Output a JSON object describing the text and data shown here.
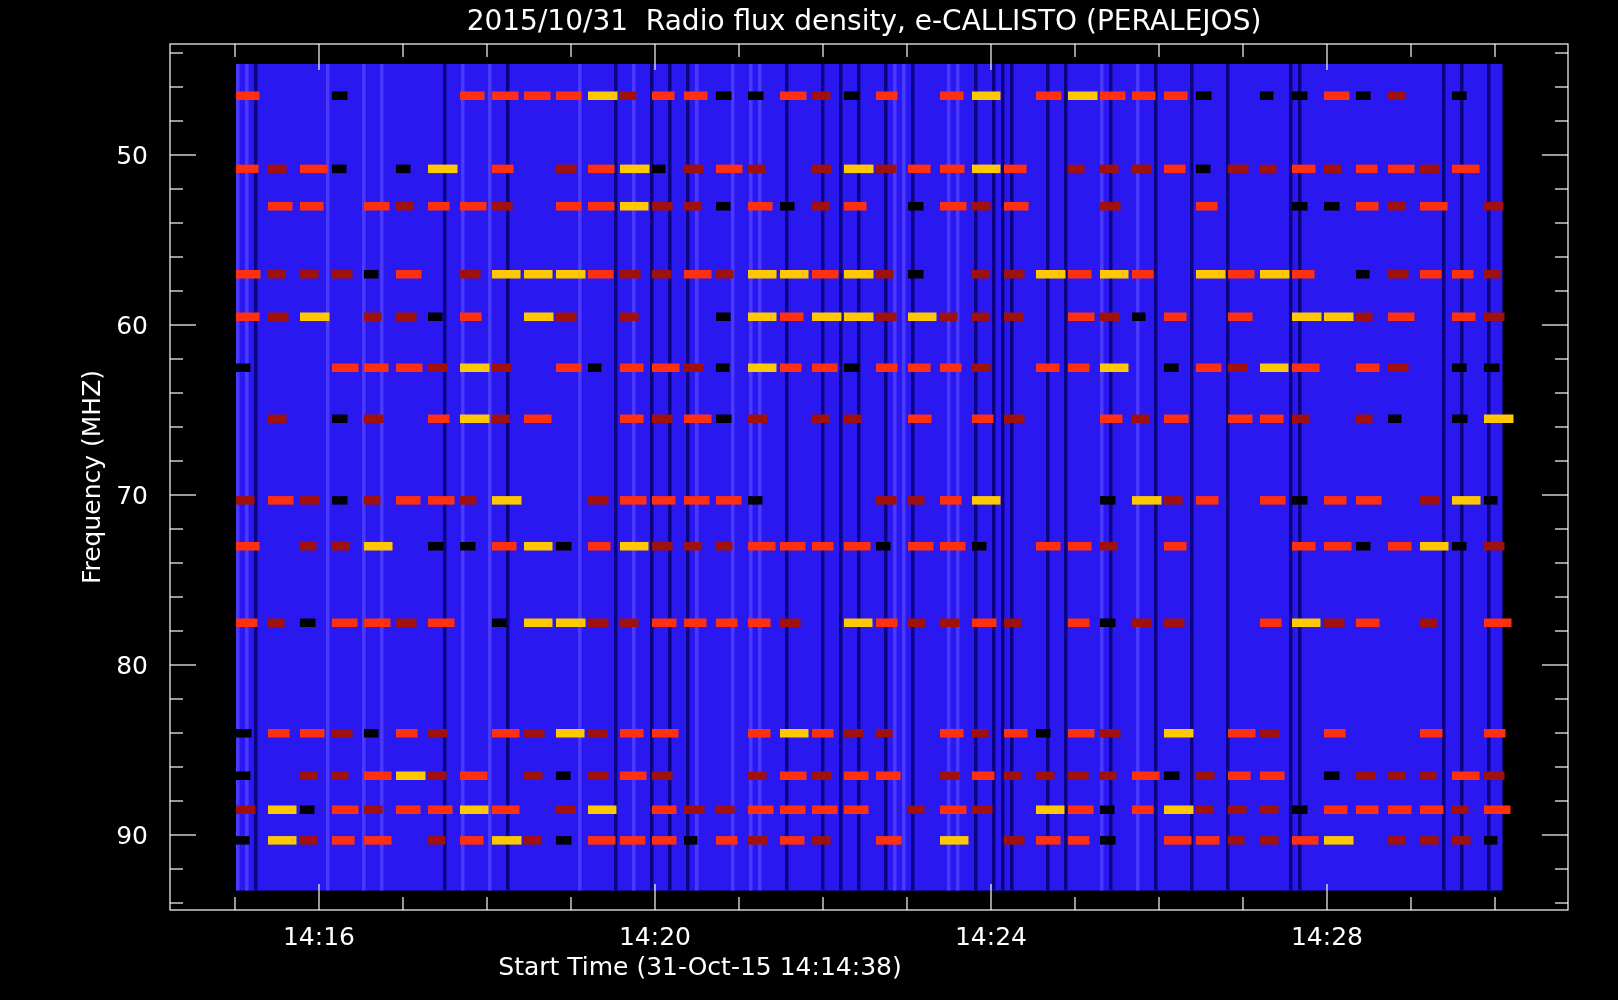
{
  "chart": {
    "title": "2015/10/31  Radio flux density, e-CALLISTO (PERALEJOS)",
    "xlabel": "Start Time (31-Oct-15 14:14:38)",
    "ylabel": "Frequency (MHZ)",
    "xticks": [
      "14:16",
      "14:20",
      "14:24",
      "14:28"
    ],
    "yticks": [
      "50",
      "60",
      "70",
      "80",
      "90"
    ]
  }
}
